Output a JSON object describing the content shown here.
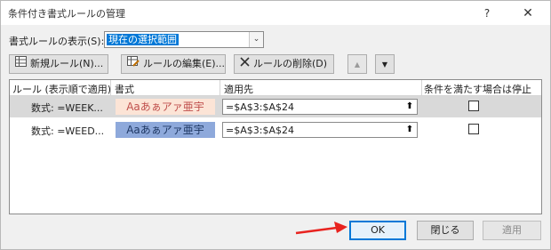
{
  "window": {
    "title": "条件付き書式ルールの管理",
    "help_label": "?",
    "close_label": "✕"
  },
  "scope": {
    "label": "書式ルールの表示(S):",
    "selected": "現在の選択範囲"
  },
  "toolbar": {
    "new_rule": "新規ルール(N)...",
    "edit_rule": "ルールの編集(E)...",
    "delete_rule": "ルールの削除(D)",
    "move_up": "▲",
    "move_down": "▼"
  },
  "rules_table": {
    "headers": [
      "ルール (表示順で適用)",
      "書式",
      "適用先",
      "条件を満たす場合は停止"
    ],
    "rows": [
      {
        "rule": "数式: =WEEK...",
        "format_preview": "Aaあぁアァ亜宇",
        "preview_bg": "#fce4d6",
        "preview_color": "#c0504d",
        "applies_to": "=$A$3:$A$24",
        "stop_if_true": false,
        "selected": true
      },
      {
        "rule": "数式: =WEED...",
        "format_preview": "Aaあぁアァ亜宇",
        "preview_bg": "#8ea9db",
        "preview_color": "#1f3864",
        "applies_to": "=$A$3:$A$24",
        "stop_if_true": false,
        "selected": false
      }
    ]
  },
  "buttons": {
    "ok": "OK",
    "close": "閉じる",
    "apply": "適用"
  },
  "colors": {
    "accent": "#0078d7",
    "annotation_arrow": "#e8231f"
  }
}
